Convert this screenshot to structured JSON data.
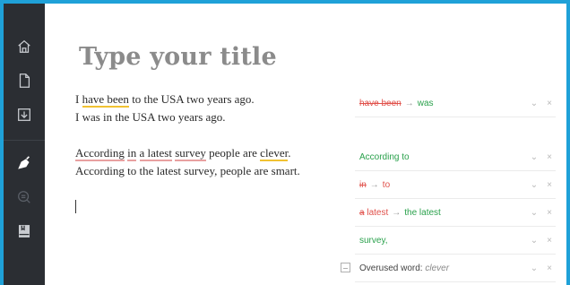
{
  "sidebar": {
    "icons": [
      "home-icon",
      "document-icon",
      "download-icon",
      "pen-icon",
      "search-icon",
      "book-icon"
    ]
  },
  "editor": {
    "title_placeholder": "Type your title",
    "p1": {
      "line1": {
        "w1": "I ",
        "w2": "have been",
        "w3": " to the USA two years ago."
      },
      "line2": "I was in the USA two years ago."
    },
    "p2": {
      "line1": {
        "w1": "According",
        "w2": " ",
        "w3": "in",
        "w4": " ",
        "w5": "a latest",
        "w6": " ",
        "w7": "survey",
        "w8": " people are ",
        "w9": "clever",
        "w10": "."
      },
      "line2": "According to the latest survey, people are smart."
    }
  },
  "suggestions": [
    {
      "from": "have been",
      "to": "was"
    },
    {
      "text": "According to"
    },
    {
      "from": "in",
      "to": "to"
    },
    {
      "from": "a",
      "to": "latest",
      "result": "the latest"
    },
    {
      "text": "survey,"
    },
    {
      "label": "Overused word: ",
      "word": "clever"
    }
  ],
  "actions": {
    "expand": "⌄",
    "dismiss": "×",
    "arrow": "→"
  },
  "colors": {
    "accent_border": "#1fa1d8",
    "sidebar": "#2b2e33",
    "green": "#2aa14c",
    "red": "#e0504a"
  }
}
